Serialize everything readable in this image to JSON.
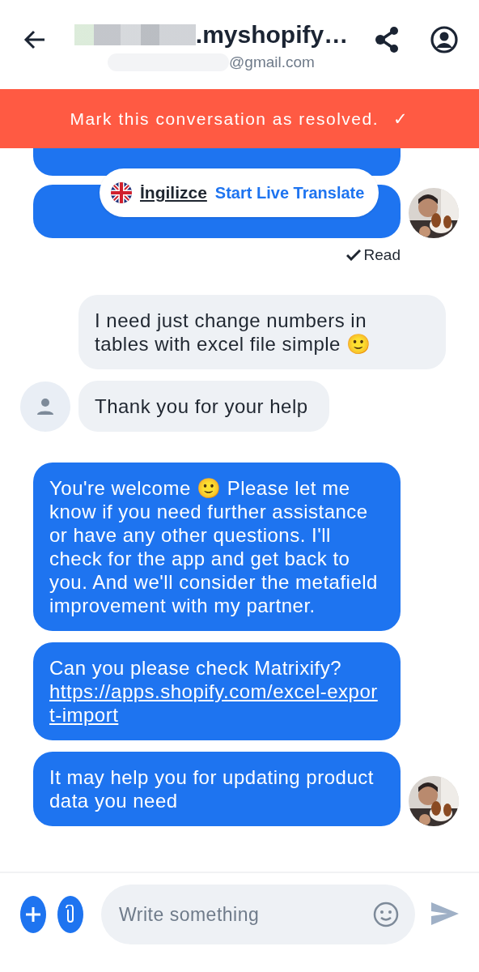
{
  "header": {
    "title": ".myshopify…",
    "subtitle": "@gmail.com"
  },
  "banner": {
    "text": "Mark this conversation as resolved.",
    "check": "✓"
  },
  "translate_chip": {
    "language": "İngilizce",
    "action": "Start Live Translate"
  },
  "messages": [
    {
      "kind": "outgoing",
      "cut": true,
      "avatar": false
    },
    {
      "kind": "outgoing",
      "avatar": true
    },
    {
      "kind": "status",
      "text": "Read"
    },
    {
      "kind": "incoming",
      "text": "I need just change numbers in tables with excel file simple 🙂",
      "avatar": false
    },
    {
      "kind": "incoming",
      "text": "Thank you for your help",
      "avatar": true
    },
    {
      "kind": "outgoing",
      "text": "You're welcome 🙂 Please let me know if you need further assistance or have any other questions. I'll check for the app and get back to you. And we'll consider the metafield improvement with my partner.",
      "avatar": false
    },
    {
      "kind": "outgoing",
      "text": "Can you please check Matrixify?",
      "link": "https://apps.shopify.com/excel-export-import",
      "avatar": false
    },
    {
      "kind": "outgoing",
      "text": "It may help you for updating product data you need",
      "avatar": true
    }
  ],
  "composer": {
    "placeholder": "Write something"
  }
}
